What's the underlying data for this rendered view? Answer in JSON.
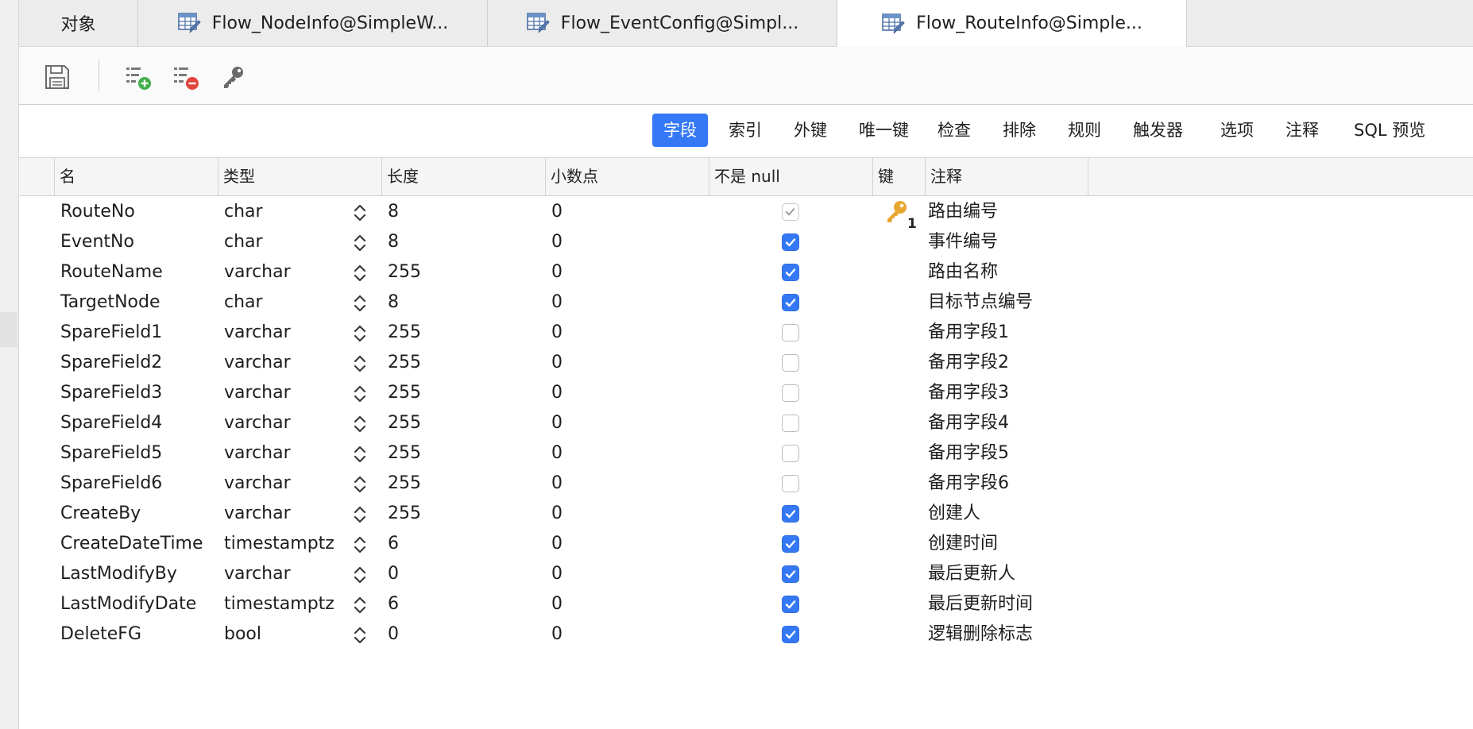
{
  "tabs": [
    {
      "label": "对象",
      "has_icon": false
    },
    {
      "label": "Flow_NodeInfo@SimpleW...",
      "has_icon": true
    },
    {
      "label": "Flow_EventConfig@Simpl...",
      "has_icon": true
    },
    {
      "label": "Flow_RouteInfo@Simple...",
      "has_icon": true,
      "active": true
    }
  ],
  "toolbar": {
    "icons": [
      "save-icon",
      "add-field-icon",
      "remove-field-icon",
      "primary-key-icon"
    ]
  },
  "subtabs": [
    "字段",
    "索引",
    "外键",
    "唯一键",
    "检查",
    "排除",
    "规则",
    "触发器",
    "选项",
    "注释",
    "SQL 预览"
  ],
  "columns": {
    "name": "名",
    "type": "类型",
    "length": "长度",
    "decimal": "小数点",
    "not_null": "不是 null",
    "key": "键",
    "comment": "注释"
  },
  "rows": [
    {
      "name": "RouteNo",
      "type": "char",
      "length": "8",
      "decimal": "0",
      "not_null": true,
      "dim": true,
      "key": "1",
      "comment": "路由编号"
    },
    {
      "name": "EventNo",
      "type": "char",
      "length": "8",
      "decimal": "0",
      "not_null": true,
      "comment": "事件编号"
    },
    {
      "name": "RouteName",
      "type": "varchar",
      "length": "255",
      "decimal": "0",
      "not_null": true,
      "comment": "路由名称"
    },
    {
      "name": "TargetNode",
      "type": "char",
      "length": "8",
      "decimal": "0",
      "not_null": true,
      "comment": "目标节点编号"
    },
    {
      "name": "SpareField1",
      "type": "varchar",
      "length": "255",
      "decimal": "0",
      "not_null": false,
      "comment": "备用字段1"
    },
    {
      "name": "SpareField2",
      "type": "varchar",
      "length": "255",
      "decimal": "0",
      "not_null": false,
      "comment": "备用字段2"
    },
    {
      "name": "SpareField3",
      "type": "varchar",
      "length": "255",
      "decimal": "0",
      "not_null": false,
      "comment": "备用字段3"
    },
    {
      "name": "SpareField4",
      "type": "varchar",
      "length": "255",
      "decimal": "0",
      "not_null": false,
      "comment": "备用字段4"
    },
    {
      "name": "SpareField5",
      "type": "varchar",
      "length": "255",
      "decimal": "0",
      "not_null": false,
      "comment": "备用字段5"
    },
    {
      "name": "SpareField6",
      "type": "varchar",
      "length": "255",
      "decimal": "0",
      "not_null": false,
      "comment": "备用字段6"
    },
    {
      "name": "CreateBy",
      "type": "varchar",
      "length": "255",
      "decimal": "0",
      "not_null": true,
      "comment": "创建人"
    },
    {
      "name": "CreateDateTime",
      "type": "timestamptz",
      "length": "6",
      "decimal": "0",
      "not_null": true,
      "comment": "创建时间"
    },
    {
      "name": "LastModifyBy",
      "type": "varchar",
      "length": "0",
      "decimal": "0",
      "not_null": true,
      "comment": "最后更新人"
    },
    {
      "name": "LastModifyDate",
      "type": "timestamptz",
      "length": "6",
      "decimal": "0",
      "not_null": true,
      "comment": "最后更新时间"
    },
    {
      "name": "DeleteFG",
      "type": "bool",
      "length": "0",
      "decimal": "0",
      "not_null": true,
      "comment": "逻辑删除标志"
    }
  ],
  "colors": {
    "accent": "#3478f6",
    "key_gold": "#e8a732"
  }
}
